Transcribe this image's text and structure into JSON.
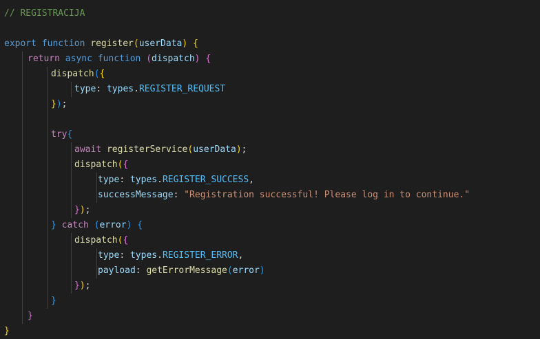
{
  "editor": {
    "theme": "dark",
    "background": "#1e1e1e",
    "colors": {
      "comment": "#6a9955",
      "keyword": "#569cd6",
      "control": "#c586c0",
      "function": "#dcdcaa",
      "variable": "#9cdcfe",
      "constant": "#4fc1ff",
      "string": "#ce9178",
      "bracket_level_1": "#ffd700",
      "bracket_level_2": "#da70d6",
      "bracket_level_3": "#179fff"
    },
    "lines": [
      {
        "indent": 0,
        "tokens": [
          {
            "t": "// REGISTRACIJA",
            "c": "comment"
          }
        ]
      },
      {
        "indent": 0,
        "tokens": []
      },
      {
        "indent": 0,
        "tokens": [
          {
            "t": "export",
            "c": "keyword"
          },
          {
            "t": " ",
            "c": "punct"
          },
          {
            "t": "function",
            "c": "keyword"
          },
          {
            "t": " ",
            "c": "punct"
          },
          {
            "t": "register",
            "c": "func"
          },
          {
            "t": "(",
            "c": "b1"
          },
          {
            "t": "userData",
            "c": "var"
          },
          {
            "t": ")",
            "c": "b1"
          },
          {
            "t": " ",
            "c": "punct"
          },
          {
            "t": "{",
            "c": "b1"
          }
        ]
      },
      {
        "indent": 1,
        "tokens": [
          {
            "t": "return",
            "c": "control"
          },
          {
            "t": " ",
            "c": "punct"
          },
          {
            "t": "async",
            "c": "keyword"
          },
          {
            "t": " ",
            "c": "punct"
          },
          {
            "t": "function",
            "c": "keyword"
          },
          {
            "t": " ",
            "c": "punct"
          },
          {
            "t": "(",
            "c": "b2"
          },
          {
            "t": "dispatch",
            "c": "var"
          },
          {
            "t": ")",
            "c": "b2"
          },
          {
            "t": " ",
            "c": "punct"
          },
          {
            "t": "{",
            "c": "b2"
          }
        ]
      },
      {
        "indent": 2,
        "tokens": [
          {
            "t": "dispatch",
            "c": "func"
          },
          {
            "t": "(",
            "c": "b3"
          },
          {
            "t": "{",
            "c": "b1"
          }
        ]
      },
      {
        "indent": 3,
        "tokens": [
          {
            "t": "type",
            "c": "var"
          },
          {
            "t": ": ",
            "c": "punct"
          },
          {
            "t": "types",
            "c": "var"
          },
          {
            "t": ".",
            "c": "punct"
          },
          {
            "t": "REGISTER_REQUEST",
            "c": "const"
          }
        ]
      },
      {
        "indent": 2,
        "tokens": [
          {
            "t": "}",
            "c": "b1"
          },
          {
            "t": ")",
            "c": "b3"
          },
          {
            "t": ";",
            "c": "punct"
          }
        ]
      },
      {
        "indent": 0,
        "tokens": []
      },
      {
        "indent": 2,
        "tokens": [
          {
            "t": "try",
            "c": "control"
          },
          {
            "t": "{",
            "c": "b3"
          }
        ]
      },
      {
        "indent": 3,
        "tokens": [
          {
            "t": "await",
            "c": "control"
          },
          {
            "t": " ",
            "c": "punct"
          },
          {
            "t": "registerService",
            "c": "func"
          },
          {
            "t": "(",
            "c": "b1"
          },
          {
            "t": "userData",
            "c": "var"
          },
          {
            "t": ")",
            "c": "b1"
          },
          {
            "t": ";",
            "c": "punct"
          }
        ]
      },
      {
        "indent": 3,
        "tokens": [
          {
            "t": "dispatch",
            "c": "func"
          },
          {
            "t": "(",
            "c": "b1"
          },
          {
            "t": "{",
            "c": "b2"
          }
        ]
      },
      {
        "indent": 4,
        "tokens": [
          {
            "t": "type",
            "c": "var"
          },
          {
            "t": ": ",
            "c": "punct"
          },
          {
            "t": "types",
            "c": "var"
          },
          {
            "t": ".",
            "c": "punct"
          },
          {
            "t": "REGISTER_SUCCESS",
            "c": "const"
          },
          {
            "t": ",",
            "c": "punct"
          }
        ]
      },
      {
        "indent": 4,
        "tokens": [
          {
            "t": "successMessage",
            "c": "var"
          },
          {
            "t": ": ",
            "c": "punct"
          },
          {
            "t": "\"Registration successful! Please log in to continue.\"",
            "c": "string"
          }
        ]
      },
      {
        "indent": 3,
        "tokens": [
          {
            "t": "}",
            "c": "b2"
          },
          {
            "t": ")",
            "c": "b1"
          },
          {
            "t": ";",
            "c": "punct"
          }
        ]
      },
      {
        "indent": 2,
        "tokens": [
          {
            "t": "}",
            "c": "b3"
          },
          {
            "t": " ",
            "c": "punct"
          },
          {
            "t": "catch",
            "c": "control"
          },
          {
            "t": " ",
            "c": "punct"
          },
          {
            "t": "(",
            "c": "b3"
          },
          {
            "t": "error",
            "c": "var"
          },
          {
            "t": ")",
            "c": "b3"
          },
          {
            "t": " ",
            "c": "punct"
          },
          {
            "t": "{",
            "c": "b3"
          }
        ]
      },
      {
        "indent": 3,
        "tokens": [
          {
            "t": "dispatch",
            "c": "func"
          },
          {
            "t": "(",
            "c": "b1"
          },
          {
            "t": "{",
            "c": "b2"
          }
        ]
      },
      {
        "indent": 4,
        "tokens": [
          {
            "t": "type",
            "c": "var"
          },
          {
            "t": ": ",
            "c": "punct"
          },
          {
            "t": "types",
            "c": "var"
          },
          {
            "t": ".",
            "c": "punct"
          },
          {
            "t": "REGISTER_ERROR",
            "c": "const"
          },
          {
            "t": ",",
            "c": "punct"
          }
        ]
      },
      {
        "indent": 4,
        "tokens": [
          {
            "t": "payload",
            "c": "var"
          },
          {
            "t": ": ",
            "c": "punct"
          },
          {
            "t": "getErrorMessage",
            "c": "func"
          },
          {
            "t": "(",
            "c": "b3"
          },
          {
            "t": "error",
            "c": "var"
          },
          {
            "t": ")",
            "c": "b3"
          }
        ]
      },
      {
        "indent": 3,
        "tokens": [
          {
            "t": "}",
            "c": "b2"
          },
          {
            "t": ")",
            "c": "b1"
          },
          {
            "t": ";",
            "c": "punct"
          }
        ]
      },
      {
        "indent": 2,
        "tokens": [
          {
            "t": "}",
            "c": "b3"
          }
        ]
      },
      {
        "indent": 1,
        "tokens": [
          {
            "t": "}",
            "c": "b2"
          }
        ]
      },
      {
        "indent": 0,
        "tokens": [
          {
            "t": "}",
            "c": "b1"
          }
        ]
      }
    ]
  }
}
